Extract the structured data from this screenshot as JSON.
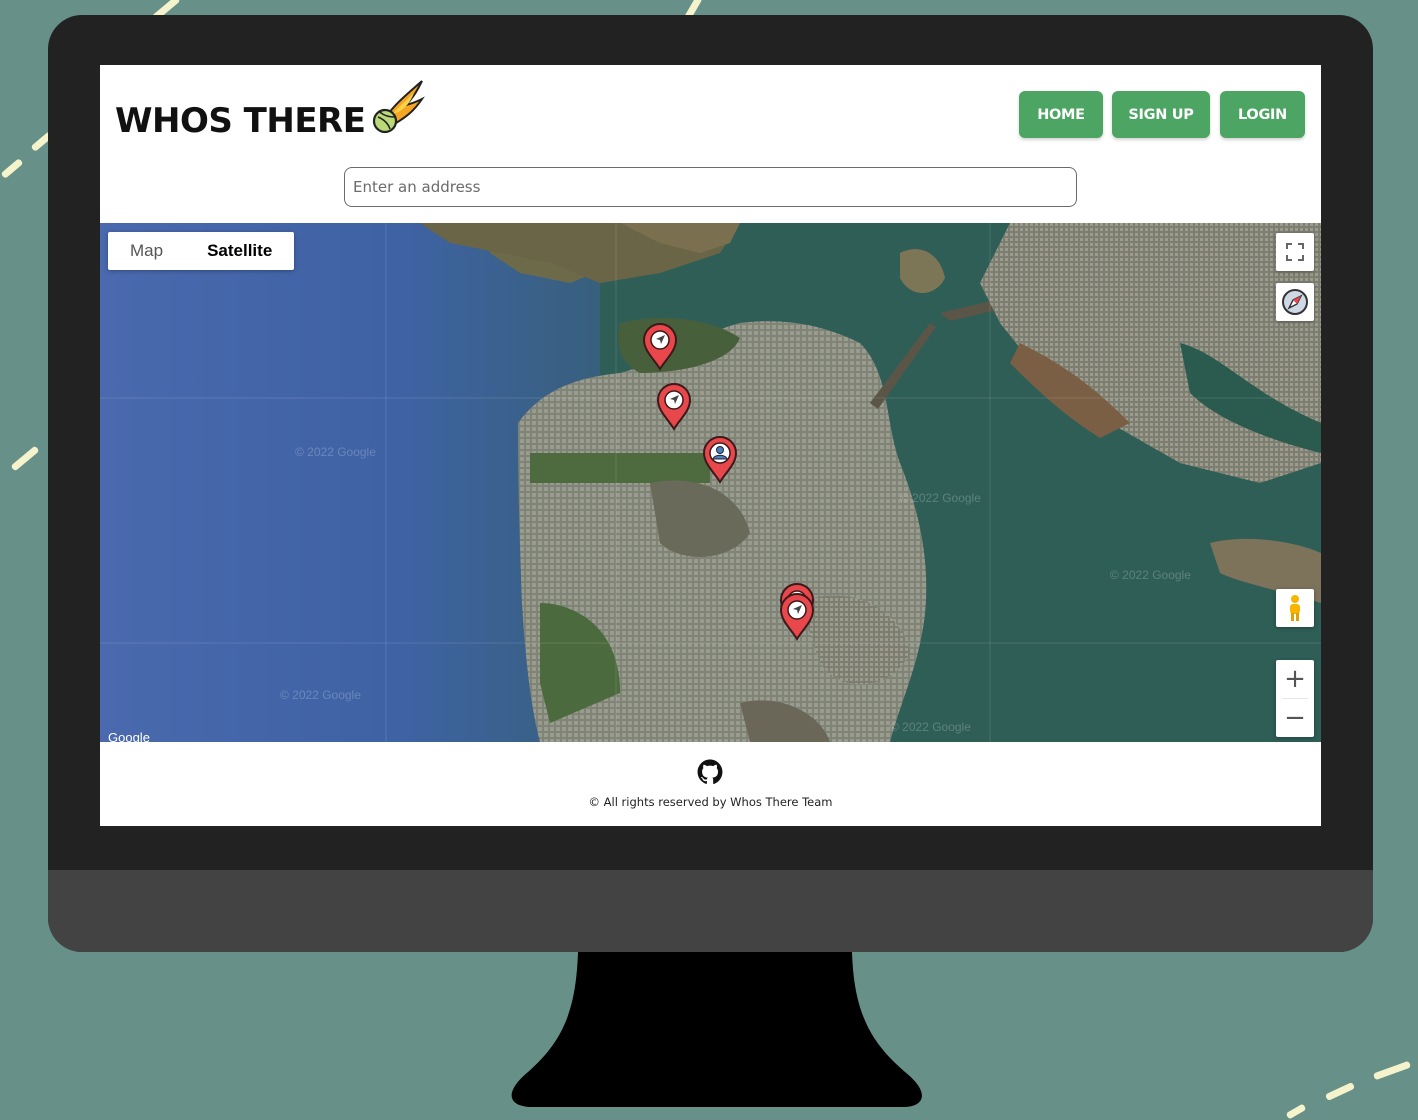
{
  "header": {
    "logo_text": "WHOS THERE",
    "logo_icon": "comet-icon"
  },
  "nav": {
    "home": "HOME",
    "signup": "SIGN UP",
    "login": "LOGIN"
  },
  "search": {
    "placeholder": "Enter an address",
    "value": ""
  },
  "map": {
    "type_options": [
      "Map",
      "Satellite"
    ],
    "selected_type": "Satellite",
    "controls": [
      "fullscreen-icon",
      "compass-icon",
      "pegman-icon",
      "zoom-in-icon",
      "zoom-out-icon"
    ],
    "zoom_in": "+",
    "zoom_out": "−",
    "watermark": "© 2022 Google",
    "attribution": "Google",
    "markers": [
      {
        "kind": "navigation",
        "icon": "navigation-arrow-icon"
      },
      {
        "kind": "navigation",
        "icon": "navigation-arrow-icon"
      },
      {
        "kind": "user",
        "icon": "user-icon"
      },
      {
        "kind": "navigation",
        "icon": "navigation-arrow-icon"
      },
      {
        "kind": "navigation",
        "icon": "navigation-arrow-icon"
      }
    ]
  },
  "footer": {
    "icon": "github-icon",
    "copyright": "© All rights reserved by Whos There Team"
  },
  "colors": {
    "background": "#679089",
    "button": "#4ca562",
    "marker": "#e8474b",
    "monitor_bezel": "#222222",
    "monitor_chin": "#434343"
  }
}
